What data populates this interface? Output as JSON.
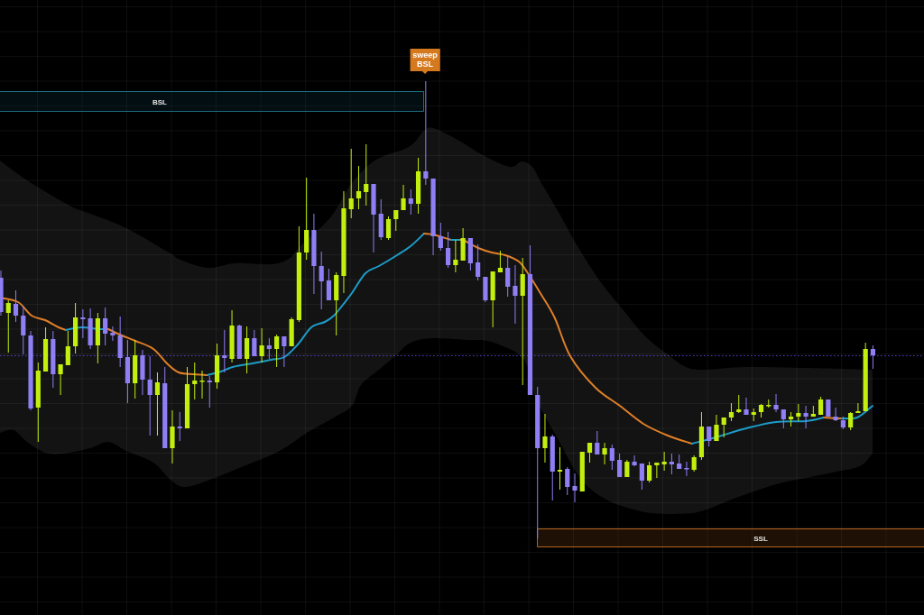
{
  "chart": {
    "zones": [
      {
        "kind": "buy",
        "label": "BSL"
      },
      {
        "kind": "sell",
        "label": "SSL"
      }
    ],
    "signal": {
      "label": "sweep BSL"
    }
  }
}
